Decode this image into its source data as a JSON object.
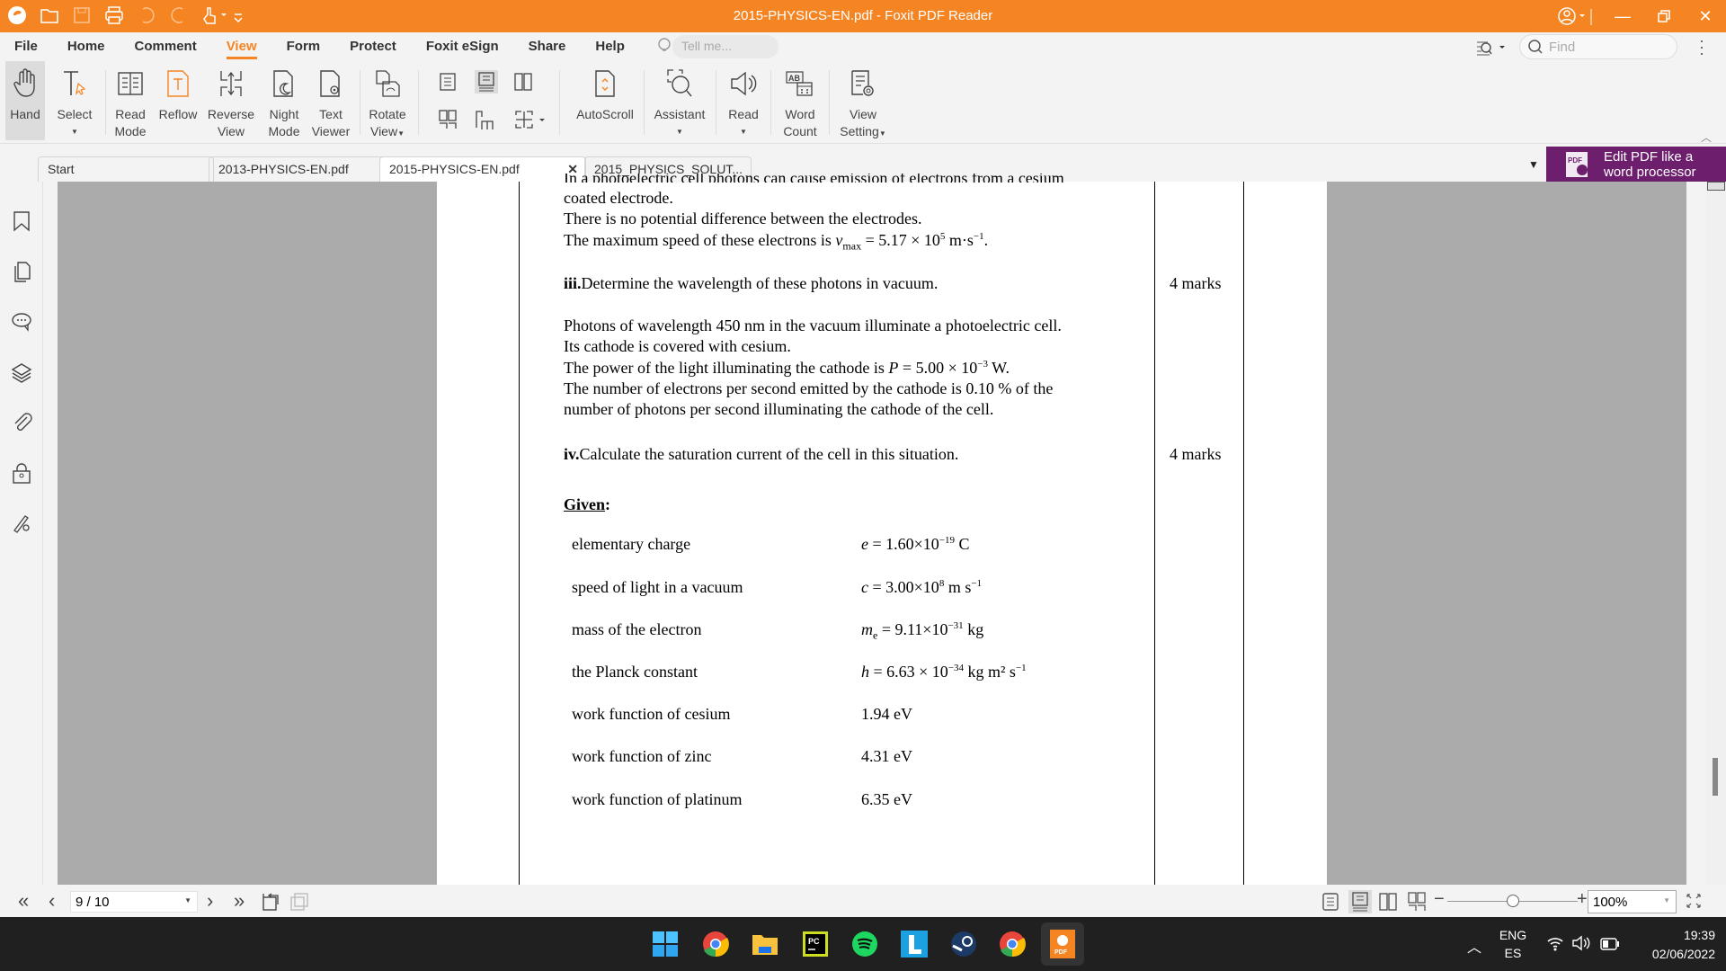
{
  "window": {
    "title": "2015-PHYSICS-EN.pdf - Foxit PDF Reader",
    "accent_color": "#f58423"
  },
  "quick_access": [
    "foxit-logo-icon",
    "open-icon",
    "save-icon",
    "print-icon",
    "undo-icon",
    "redo-icon",
    "hand-touch-icon",
    "customize-icon"
  ],
  "menu": {
    "items": [
      "File",
      "Home",
      "Comment",
      "View",
      "Form",
      "Protect",
      "Foxit eSign",
      "Share",
      "Help"
    ],
    "active": "View",
    "tell_me_placeholder": "Tell me...",
    "find_placeholder": "Find"
  },
  "ribbon": {
    "hand": "Hand",
    "select": "Select",
    "read_mode": [
      "Read",
      "Mode"
    ],
    "reflow": "Reflow",
    "reverse_view": [
      "Reverse",
      "View"
    ],
    "night_mode": [
      "Night",
      "Mode"
    ],
    "text_viewer": [
      "Text",
      "Viewer"
    ],
    "rotate_view": [
      "Rotate",
      "View"
    ],
    "autoscroll": "AutoScroll",
    "assistant": "Assistant",
    "read": "Read",
    "word_count": [
      "Word",
      "Count"
    ],
    "view_setting": [
      "View",
      "Setting"
    ]
  },
  "tabs": [
    {
      "label": "Start"
    },
    {
      "label": "2013-PHYSICS-EN.pdf"
    },
    {
      "label": "2015-PHYSICS-EN.pdf",
      "active": true
    },
    {
      "label": "2015_PHYSICS_SOLUT..."
    }
  ],
  "promo": {
    "line1": "Edit PDF like a",
    "line2": "word processor",
    "color": "#6d1f6d"
  },
  "document": {
    "cut_line": "In a photoelectric cell photons can cause emission of electrons from a cesium",
    "p1": [
      "coated electrode.",
      "There is no potential difference between the electrodes."
    ],
    "p1_speed_prefix": "The maximum speed of these electrons is ",
    "p1_speed_var": "v",
    "p1_speed_sub": "max",
    "p1_speed_val": " = 5.17 × 10",
    "p1_speed_exp": "5",
    "p1_speed_unit": " m·s",
    "p1_speed_unit_exp": "−1",
    "q3_num": "iii.",
    "q3_text": "Determine the wavelength of these photons in vacuum.",
    "q3_marks": "4 marks",
    "p2_l1": "Photons of wavelength 450 nm in the vacuum illuminate a photoelectric cell.",
    "p2_l2": "Its cathode is covered with cesium.",
    "p2_l3_prefix": "The power of the light illuminating the cathode is ",
    "p2_l3_var": "P",
    "p2_l3_val": " = 5.00 × 10",
    "p2_l3_exp": "−3",
    "p2_l3_unit": " W.",
    "p2_l4": "The number of electrons per second emitted by the cathode is 0.10 % of the",
    "p2_l5": "number of photons per second illuminating the cathode of the cell.",
    "q4_num": "iv.",
    "q4_text": "Calculate the saturation current of the cell in this situation.",
    "q4_marks": "4 marks",
    "given_title": "Given",
    "given": [
      {
        "name": "elementary charge",
        "sym": "e",
        "val": " = 1.60×10",
        "exp": "−19",
        "unit": " C",
        "unit_exp": ""
      },
      {
        "name": "speed of light in a vacuum",
        "sym": "c",
        "val": " = 3.00×10",
        "exp": "8",
        "unit": " m s",
        "unit_exp": "−1"
      },
      {
        "name": "mass of the electron",
        "sym": "m",
        "sub": "e",
        "val": " = 9.11×10",
        "exp": "−31",
        "unit": " kg",
        "unit_exp": ""
      },
      {
        "name": "the Planck constant",
        "sym": "h",
        "val": " = 6.63 × 10",
        "exp": "−34",
        "unit": " kg m² s",
        "unit_exp": "−1"
      },
      {
        "name": "work function of cesium",
        "sym": "",
        "val": "1.94 eV",
        "exp": "",
        "unit": "",
        "unit_exp": ""
      },
      {
        "name": "work function of zinc",
        "sym": "",
        "val": "4.31 eV",
        "exp": "",
        "unit": "",
        "unit_exp": ""
      },
      {
        "name": "work function of platinum",
        "sym": "",
        "val": "6.35 eV",
        "exp": "",
        "unit": "",
        "unit_exp": ""
      }
    ]
  },
  "statusbar": {
    "page_indicator": "9 / 10",
    "zoom": "100%",
    "zoom_fraction": 0.5
  },
  "taskbar": {
    "apps": [
      "windows-start-icon",
      "chrome-icon",
      "file-explorer-icon",
      "pycharm-icon",
      "spotify-icon",
      "l-app-icon",
      "steam-icon",
      "chrome-icon",
      "foxit-pdf-icon"
    ],
    "lang1": "ENG",
    "lang2": "ES",
    "time": "19:39",
    "date": "02/06/2022"
  }
}
